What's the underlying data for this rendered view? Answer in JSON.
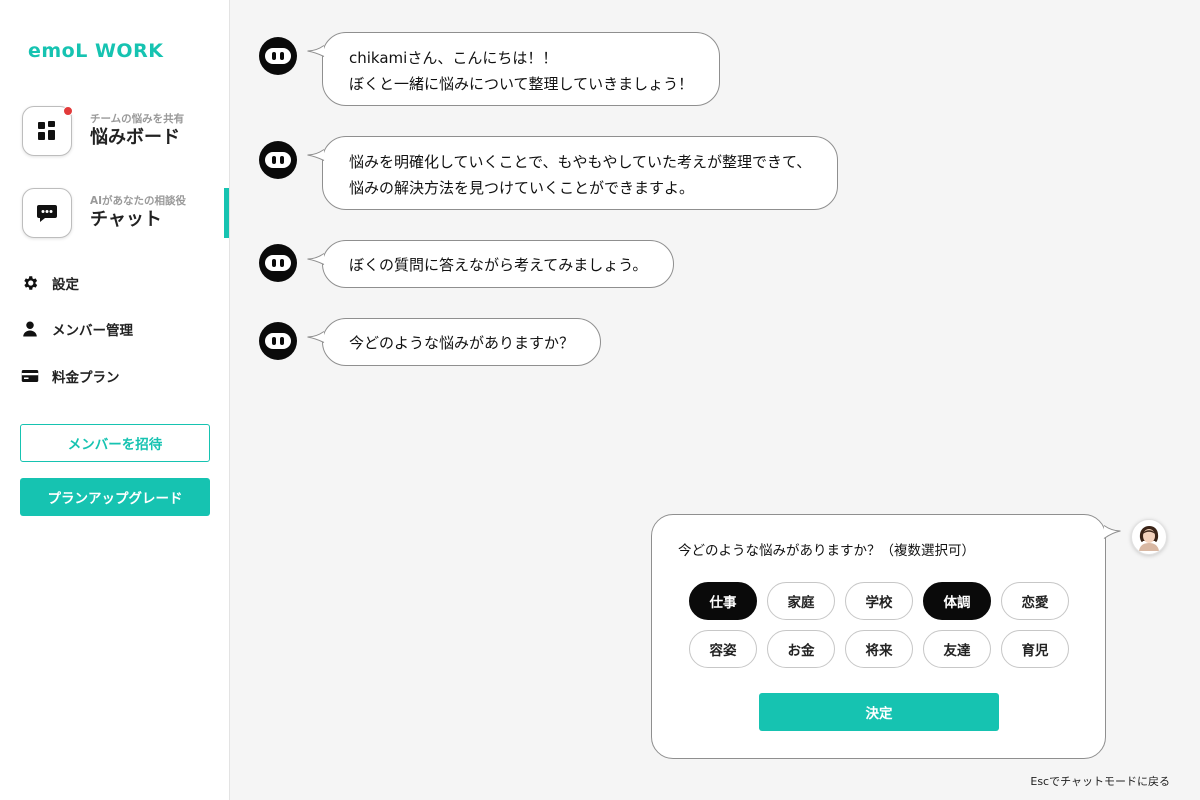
{
  "sidebar": {
    "logo": "emoL WORK",
    "nav_cards": [
      {
        "sub": "チームの悩みを共有",
        "main": "悩みボード",
        "icon": "grid-icon",
        "badge": true
      },
      {
        "sub": "AIがあなたの相談役",
        "main": "チャット",
        "icon": "chat-icon",
        "active": true
      }
    ],
    "menu": [
      {
        "label": "設定",
        "icon": "gear-icon"
      },
      {
        "label": "メンバー管理",
        "icon": "person-icon"
      },
      {
        "label": "料金プラン",
        "icon": "card-icon"
      }
    ],
    "invite_button": "メンバーを招待",
    "upgrade_button": "プランアップグレード"
  },
  "chat": {
    "messages": [
      {
        "lines": [
          "chikamiさん、こんにちは！！",
          "ぼくと一緒に悩みについて整理していきましょう！"
        ]
      },
      {
        "lines": [
          "悩みを明確化していくことで、もやもやしていた考えが整理できて、",
          "悩みの解決方法を見つけていくことができますよ。"
        ]
      },
      {
        "lines": [
          "ぼくの質問に答えながら考えてみましょう。"
        ]
      },
      {
        "lines": [
          "今どのような悩みがありますか？"
        ]
      }
    ]
  },
  "question_panel": {
    "question": "今どのような悩みがありますか？（複数選択可）",
    "options": [
      {
        "label": "仕事",
        "selected": true
      },
      {
        "label": "家庭",
        "selected": false
      },
      {
        "label": "学校",
        "selected": false
      },
      {
        "label": "体調",
        "selected": true
      },
      {
        "label": "恋愛",
        "selected": false
      },
      {
        "label": "容姿",
        "selected": false
      },
      {
        "label": "お金",
        "selected": false
      },
      {
        "label": "将来",
        "selected": false
      },
      {
        "label": "友達",
        "selected": false
      },
      {
        "label": "育児",
        "selected": false
      }
    ],
    "submit_button": "決定"
  },
  "esc_hint": "Escでチャットモードに戻る",
  "colors": {
    "accent": "#16c3b1",
    "badge": "#e23a3a",
    "selected_chip": "#0a0a0a"
  }
}
